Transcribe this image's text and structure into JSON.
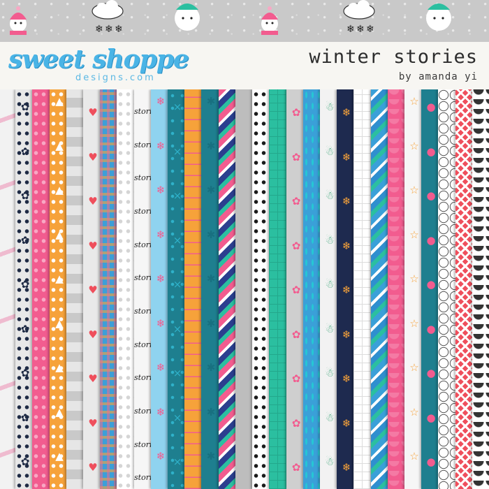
{
  "brand": {
    "logo_main": "sweet shoppe",
    "logo_sub": "designs.com",
    "colors": {
      "logo": "#4ab4e6",
      "banner": "#c9c9c9",
      "header_bg": "#f7f6f2"
    }
  },
  "kit": {
    "title": "winter stories",
    "author": "by amanda yi"
  },
  "banner_icons": [
    "snowman-icon",
    "cloud-icon",
    "snowflake-icon",
    "snowball-face-icon"
  ],
  "papers": [
    {
      "color": "#f2f2f2",
      "pattern": "brush",
      "accent": "#e94d8a",
      "deco": "",
      "icon": "brush-stroke-icon"
    },
    {
      "color": "#e8e8e8",
      "pattern": "dots",
      "accent": "#1e2a44",
      "deco": "✿",
      "icon": "berry-branch-icon"
    },
    {
      "color": "#f25c8f",
      "pattern": "dots",
      "accent": "#f8a8c4",
      "deco": "",
      "icon": "dot-pattern-icon"
    },
    {
      "color": "#f6a23a",
      "pattern": "dots",
      "accent": "#ffffff",
      "deco": "▲",
      "icon": "triangle-icon"
    },
    {
      "color": "#c9c9c9",
      "pattern": "checks",
      "accent": "#e6e6e6",
      "deco": "",
      "icon": "gingham-icon"
    },
    {
      "color": "#e9e9e9",
      "pattern": "hearts",
      "accent": "#ef4f5c",
      "deco": "♥",
      "icon": "heart-icon"
    },
    {
      "color": "#3c9fd8",
      "pattern": "plaid",
      "accent": "#f26a8f",
      "deco": "",
      "icon": "plaid-icon"
    },
    {
      "color": "#ffffff",
      "pattern": "dots",
      "accent": "#d5d5d5",
      "deco": "",
      "icon": "dot-pattern-icon"
    },
    {
      "color": "#f6f6f6",
      "pattern": "script",
      "accent": "#222222",
      "deco": "stories",
      "icon": "script-text-icon"
    },
    {
      "color": "#8fd3ef",
      "pattern": "snowflakes",
      "accent": "#f25c8f",
      "deco": "❄",
      "icon": "snowflake-icon"
    },
    {
      "color": "#1e7f8f",
      "pattern": "crosses",
      "accent": "#2fb1c9",
      "deco": "×",
      "icon": "cross-icon"
    },
    {
      "color": "#f6a23a",
      "pattern": "lines",
      "accent": "#f25c8f",
      "deco": "",
      "icon": "ruled-line-icon"
    },
    {
      "color": "#1e7f8f",
      "pattern": "solid",
      "accent": "#187080",
      "deco": "✱",
      "icon": "starburst-icon"
    },
    {
      "color": "#f25c8f",
      "pattern": "stripes",
      "accent": "#2b3f8f",
      "deco": "",
      "icon": "diagonal-stripe-icon"
    },
    {
      "color": "#bdbdbd",
      "pattern": "loops",
      "accent": "#ffffff",
      "deco": "",
      "icon": "loop-icon"
    },
    {
      "color": "#ffffff",
      "pattern": "dots",
      "accent": "#1a1a1a",
      "deco": "",
      "icon": "dot-pattern-icon"
    },
    {
      "color": "#2bbfa0",
      "pattern": "grid",
      "accent": "#23a88c",
      "deco": "",
      "icon": "grid-icon"
    },
    {
      "color": "#cfcfcf",
      "pattern": "flowers",
      "accent": "#f25c8f",
      "deco": "✿",
      "icon": "flower-icon"
    },
    {
      "color": "#3aa0d8",
      "pattern": "dashes",
      "accent": "#26c7d4",
      "deco": "",
      "icon": "dash-icon"
    },
    {
      "color": "#f2f2f2",
      "pattern": "snowmen",
      "accent": "#2f9f6f",
      "deco": "☃",
      "icon": "snowman-icon"
    },
    {
      "color": "#1e2a4f",
      "pattern": "snowflakes",
      "accent": "#f6a23a",
      "deco": "❄",
      "icon": "snowflake-icon"
    },
    {
      "color": "#ffffff",
      "pattern": "grid",
      "accent": "#dcdcdc",
      "deco": "",
      "icon": "grid-icon"
    },
    {
      "color": "#3aa0d8",
      "pattern": "stripes",
      "accent": "#2f8fcf",
      "deco": "",
      "icon": "diagonal-stripe-icon"
    },
    {
      "color": "#f25c8f",
      "pattern": "scallops",
      "accent": "#f47aa4",
      "deco": "",
      "icon": "scallop-icon"
    },
    {
      "color": "#f6f6f6",
      "pattern": "stars",
      "accent": "#f6a23a",
      "deco": "☆",
      "icon": "star-icon"
    },
    {
      "color": "#1e7f8f",
      "pattern": "circles",
      "accent": "#f25c8f",
      "deco": "●",
      "icon": "circle-icon"
    },
    {
      "color": "#ffffff",
      "pattern": "clouds",
      "accent": "#1a1a1a",
      "deco": "",
      "icon": "cloud-outline-icon"
    },
    {
      "color": "#ef4f5c",
      "pattern": "fairisle",
      "accent": "#ffffff",
      "deco": "",
      "icon": "fair-isle-icon"
    },
    {
      "color": "#ffffff",
      "pattern": "scallops",
      "accent": "#333333",
      "deco": "",
      "icon": "scallop-icon"
    }
  ]
}
